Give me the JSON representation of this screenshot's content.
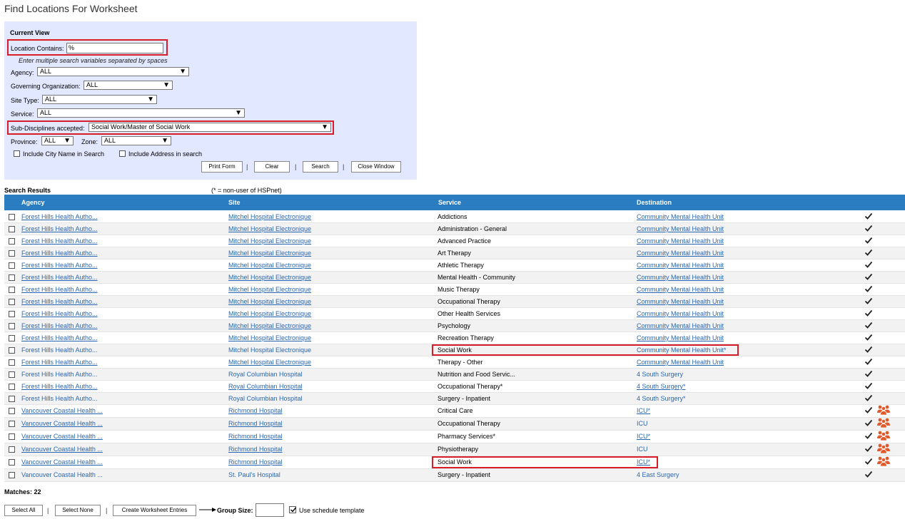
{
  "title": "Find Locations For Worksheet",
  "current_view": {
    "heading": "Current View",
    "location_label": "Location Contains:",
    "location_value": "%",
    "hint": "Enter multiple search variables separated by spaces",
    "agency_label": "Agency:",
    "agency_value": "ALL",
    "gov_org_label": "Governing Organization:",
    "gov_org_value": "ALL",
    "site_type_label": "Site Type:",
    "site_type_value": "ALL",
    "service_label": "Service:",
    "service_value": "ALL",
    "subdisc_label": "Sub-Disciplines accepted:",
    "subdisc_value": "Social Work/Master of Social Work",
    "province_label": "Province:",
    "province_value": "ALL",
    "zone_label": "Zone:",
    "zone_value": "ALL",
    "include_city": "Include City Name in Search",
    "include_address": "Include Address in search",
    "buttons": {
      "print": "Print Form",
      "clear": "Clear",
      "search": "Search",
      "close": "Close Window"
    },
    "separator": "|"
  },
  "results": {
    "heading": "Search Results",
    "legend": "(* = non-user of HSPnet)",
    "columns": {
      "agency": "Agency",
      "site": "Site",
      "service": "Service",
      "destination": "Destination"
    },
    "rows": [
      {
        "agency": "Forest Hills Health Autho...",
        "site": "Mitchel Hospital Electronique",
        "service": "Addictions",
        "destination": "Community Mental Health Unit",
        "people": false
      },
      {
        "agency": "Forest Hills Health Autho...",
        "site": "Mitchel Hospital Electronique",
        "service": "Administration - General",
        "destination": "Community Mental Health Unit",
        "people": false
      },
      {
        "agency": "Forest Hills Health Autho...",
        "site": "Mitchel Hospital Electronique",
        "service": "Advanced Practice",
        "destination": "Community Mental Health Unit",
        "people": false
      },
      {
        "agency": "Forest Hills Health Autho...",
        "site": "Mitchel Hospital Electronique",
        "service": "Art Therapy",
        "destination": "Community Mental Health Unit",
        "people": false
      },
      {
        "agency": "Forest Hills Health Autho...",
        "site": "Mitchel Hospital Electronique",
        "service": "Athletic Therapy",
        "destination": "Community Mental Health Unit",
        "people": false
      },
      {
        "agency": "Forest Hills Health Autho...",
        "site": "Mitchel Hospital Electronique",
        "service": "Mental Health - Community",
        "destination": "Community Mental Health Unit",
        "people": false
      },
      {
        "agency": "Forest Hills Health Autho...",
        "site": "Mitchel Hospital Electronique",
        "service": "Music Therapy",
        "destination": "Community Mental Health Unit",
        "people": false
      },
      {
        "agency": "Forest Hills Health Autho...",
        "site": "Mitchel Hospital Electronique",
        "service": "Occupational Therapy",
        "destination": "Community Mental Health Unit",
        "people": false
      },
      {
        "agency": "Forest Hills Health Autho...",
        "site": "Mitchel Hospital Electronique",
        "service": "Other Health Services",
        "destination": "Community Mental Health Unit",
        "people": false
      },
      {
        "agency": "Forest Hills Health Autho...",
        "site": "Mitchel Hospital Electronique",
        "service": "Psychology",
        "destination": "Community Mental Health Unit",
        "people": false
      },
      {
        "agency": "Forest Hills Health Autho...",
        "site": "Mitchel Hospital Electronique",
        "service": "Recreation Therapy",
        "destination": "Community Mental Health Unit",
        "people": false
      },
      {
        "agency": "Forest Hills Health Autho...",
        "site": "Mitchel Hospital Electronique",
        "service": "Social Work",
        "destination": "Community Mental Health Unit*",
        "people": false
      },
      {
        "agency": "Forest Hills Health Autho...",
        "site": "Mitchel Hospital Electronique",
        "service": "Therapy - Other",
        "destination": "Community Mental Health Unit",
        "people": false
      },
      {
        "agency": "Forest Hills Health Autho...",
        "site": "Royal Columbian Hospital",
        "service": "Nutrition and Food Servic...",
        "destination": "4 South Surgery",
        "people": false
      },
      {
        "agency": "Forest Hills Health Autho...",
        "site": "Royal Columbian Hospital",
        "service": "Occupational Therapy*",
        "destination": "4 South Surgery*",
        "people": false
      },
      {
        "agency": "Forest Hills Health Autho...",
        "site": "Royal Columbian Hospital",
        "service": "Surgery - Inpatient",
        "destination": "4 South Surgery*",
        "people": false
      },
      {
        "agency": "Vancouver Coastal Health ...",
        "site": "Richmond Hospital",
        "service": "Critical Care",
        "destination": "ICU*",
        "people": true
      },
      {
        "agency": "Vancouver Coastal Health ...",
        "site": "Richmond Hospital",
        "service": "Occupational Therapy",
        "destination": "ICU",
        "people": true
      },
      {
        "agency": "Vancouver Coastal Health ...",
        "site": "Richmond Hospital",
        "service": "Pharmacy Services*",
        "destination": "ICU*",
        "people": true
      },
      {
        "agency": "Vancouver Coastal Health ...",
        "site": "Richmond Hospital",
        "service": "Physiotherapy",
        "destination": "ICU",
        "people": true
      },
      {
        "agency": "Vancouver Coastal Health ...",
        "site": "Richmond Hospital",
        "service": "Social Work",
        "destination": "ICU*",
        "people": true
      },
      {
        "agency": "Vancouver Coastal Health ...",
        "site": "St. Paul's Hospital",
        "service": "Surgery - Inpatient",
        "destination": "4 East Surgery",
        "people": false
      }
    ],
    "matches": "Matches: 22"
  },
  "footer": {
    "select_all": "Select All",
    "select_none": "Select None",
    "create_entries": "Create Worksheet Entries",
    "group_size_label": "Group Size:",
    "group_size_value": "",
    "use_schedule": "Use schedule template"
  },
  "colors": {
    "header_blue": "#2a7dc1",
    "panel_bg": "#e1e8ff",
    "highlight_red": "#d81c2a",
    "link_blue": "#2a66b0",
    "people_icon": "#e0592a"
  }
}
